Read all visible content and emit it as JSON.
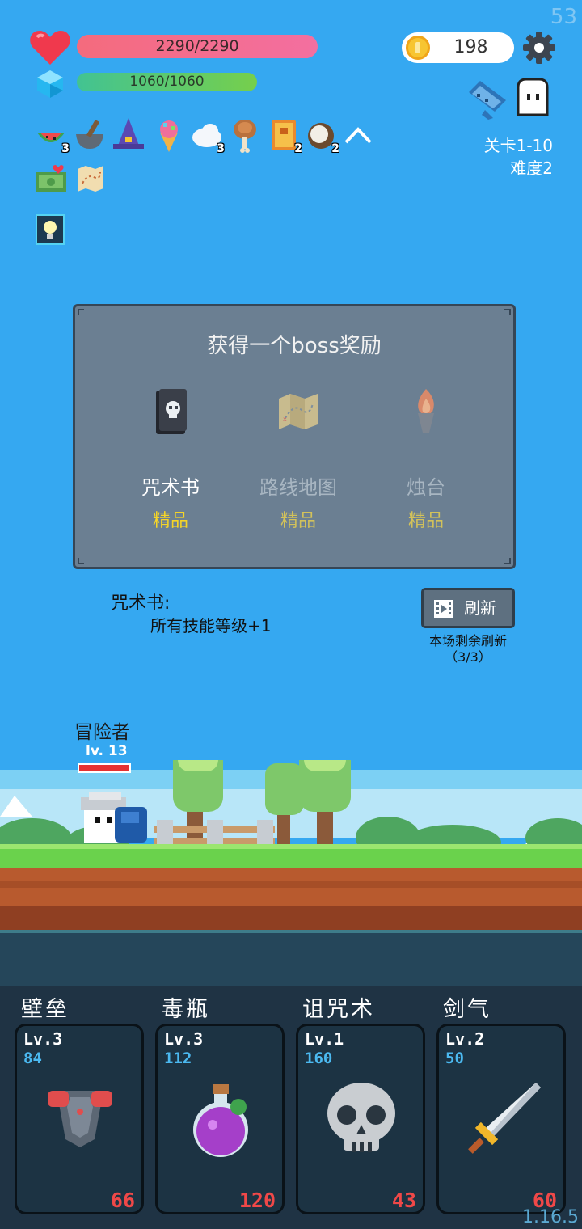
{
  "fps": "53",
  "version": "1.16.5",
  "stats": {
    "hp": "2290/2290",
    "mp": "1060/1060",
    "hp_fill": 1.0,
    "mp_fill": 1.0
  },
  "coins": "198",
  "stage": {
    "level": "关卡1-10",
    "difficulty": "难度2"
  },
  "items": [
    {
      "icon": "watermelon-icon",
      "count": "3"
    },
    {
      "icon": "mortar-icon",
      "count": ""
    },
    {
      "icon": "wizard-hat-icon",
      "count": ""
    },
    {
      "icon": "ice-cream-icon",
      "count": ""
    },
    {
      "icon": "cloud-icon",
      "count": "3"
    },
    {
      "icon": "meat-icon",
      "count": ""
    },
    {
      "icon": "book-icon",
      "count": "2"
    },
    {
      "icon": "coconut-icon",
      "count": "2"
    }
  ],
  "reward": {
    "title": "获得一个boss奖励",
    "choices": [
      {
        "name": "咒术书",
        "quality": "精品",
        "icon": "skull-book-icon"
      },
      {
        "name": "路线地图",
        "quality": "精品",
        "icon": "map-icon"
      },
      {
        "name": "烛台",
        "quality": "精品",
        "icon": "candlestick-icon"
      }
    ],
    "desc_title": "咒术书:",
    "desc_body": "所有技能等级+1",
    "refresh_label": "刷新",
    "refresh_note_1": "本场剩余刷新",
    "refresh_note_2": "（3/3）"
  },
  "hero": {
    "name": "冒险者",
    "level": "lv. 13",
    "hp_fill": 1.0
  },
  "skills": [
    {
      "title": "壁垒",
      "lv": "Lv.3",
      "cost": "84",
      "power": "66",
      "icon": "armor-icon"
    },
    {
      "title": "毒瓶",
      "lv": "Lv.3",
      "cost": "112",
      "power": "120",
      "icon": "poison-potion-icon"
    },
    {
      "title": "诅咒术",
      "lv": "Lv.1",
      "cost": "160",
      "power": "43",
      "icon": "skull-icon"
    },
    {
      "title": "剑气",
      "lv": "Lv.2",
      "cost": "50",
      "power": "60",
      "icon": "sword-icon"
    }
  ],
  "colors": {
    "sky": "#35a8f1",
    "panel": "#6b7f92",
    "quality": "#f6d526",
    "power": "#f04848",
    "cost": "#4bb9f0"
  }
}
